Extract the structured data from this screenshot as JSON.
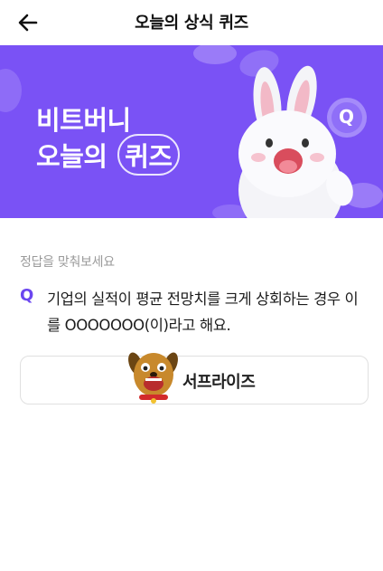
{
  "header": {
    "title": "오늘의 상식 퀴즈",
    "back_icon": "arrow-left-icon"
  },
  "banner": {
    "line1": "비트버니",
    "line2_prefix": "오늘의",
    "line2_highlight": "퀴즈",
    "background_color": "#7a52f5",
    "badge_letter": "Q"
  },
  "quiz": {
    "instruction": "정답을 맞춰보세요",
    "q_label": "Q",
    "question_line1": "기업의 실적이 평균 전망치를 크게 상회하는 경우 이",
    "question_line2": "를 OOOOOOO(이)라고 해요.",
    "answer": "서프라이즈",
    "accent_color": "#6b46f0"
  }
}
